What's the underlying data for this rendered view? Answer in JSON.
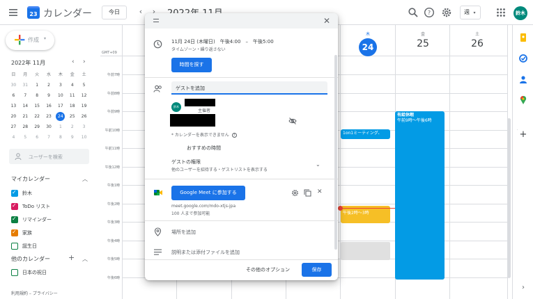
{
  "header": {
    "app_title": "カレンダー",
    "logo_text": "23",
    "today_button": "今日",
    "month_title": "2022年 11月",
    "view_select": "週",
    "avatar": "鈴木"
  },
  "sidebar": {
    "create_label": "作成",
    "mini_calendar": {
      "title": "2022年 11月",
      "weekdays": [
        "日",
        "月",
        "火",
        "水",
        "木",
        "金",
        "土"
      ],
      "weeks": [
        [
          "30",
          "31",
          "1",
          "2",
          "3",
          "4",
          "5"
        ],
        [
          "6",
          "7",
          "8",
          "9",
          "10",
          "11",
          "12"
        ],
        [
          "13",
          "14",
          "15",
          "16",
          "17",
          "18",
          "19"
        ],
        [
          "20",
          "21",
          "22",
          "23",
          "24",
          "25",
          "26"
        ],
        [
          "27",
          "28",
          "29",
          "30",
          "1",
          "2",
          "3"
        ],
        [
          "4",
          "5",
          "6",
          "7",
          "8",
          "9",
          "10"
        ]
      ],
      "today": "24"
    },
    "user_search_placeholder": "ユーザーを検索",
    "my_calendars_title": "マイカレンダー",
    "my_calendars": [
      {
        "label": "鈴木",
        "color": "#039be5",
        "checked": true
      },
      {
        "label": "ToDo リスト",
        "color": "#d81b60",
        "checked": true
      },
      {
        "label": "リマインダー",
        "color": "#0b8043",
        "checked": true
      },
      {
        "label": "家族",
        "color": "#e67c00",
        "checked": true
      },
      {
        "label": "誕生日",
        "color": "#0b8043",
        "checked": false
      }
    ],
    "other_calendars_title": "他のカレンダー",
    "other_calendars": [
      {
        "label": "日本の祝日",
        "color": "#0b8043",
        "checked": false
      }
    ],
    "footer": "利用規約 – プライバシー"
  },
  "grid": {
    "gmt_label": "GMT+09",
    "hours": [
      "午前7時",
      "午前8時",
      "午前9時",
      "午前10時",
      "午前11時",
      "午後12時",
      "午後1時",
      "午後2時",
      "午後3時",
      "午後4時",
      "午後5時",
      "午後6時"
    ],
    "days": [
      {
        "dow": "木",
        "num": "24",
        "today": true
      },
      {
        "dow": "金",
        "num": "25",
        "today": false
      },
      {
        "dow": "土",
        "num": "26",
        "today": false
      }
    ],
    "events": [
      {
        "title": "1on1ミーティング、",
        "color": "#039be5"
      },
      {
        "title": "有給休暇",
        "time": "午前9時～午後6時",
        "color": "#039be5"
      },
      {
        "title": "午後2時～3時",
        "color": "#f6bf26"
      }
    ]
  },
  "dialog": {
    "datetime": "11月 24日 (木曜日)　午後4:00　–　午後5:00",
    "timezone": "タイムゾーン・繰り返さない",
    "find_time_button": "時間を探す",
    "guest_input": "ゲストを追加",
    "organizer_label": "主催者",
    "organizer_avatar": "鈴木",
    "calendar_unavailable": "* カレンダーを表示できません",
    "suggested_times": "おすすめの時間",
    "guest_permissions_title": "ゲストの権限",
    "guest_permissions_sub": "他のユーザーを招待する・ゲストリストを表示する",
    "meet_button": "Google Meet に参加する",
    "meet_url": "meet.google.com/mdo-xtjs-jpa",
    "meet_capacity": "100 人まで参加可能",
    "add_location": "場所を追加",
    "add_description": "説明または添付ファイルを追加",
    "more_options": "その他のオプション",
    "save_button": "保存"
  }
}
